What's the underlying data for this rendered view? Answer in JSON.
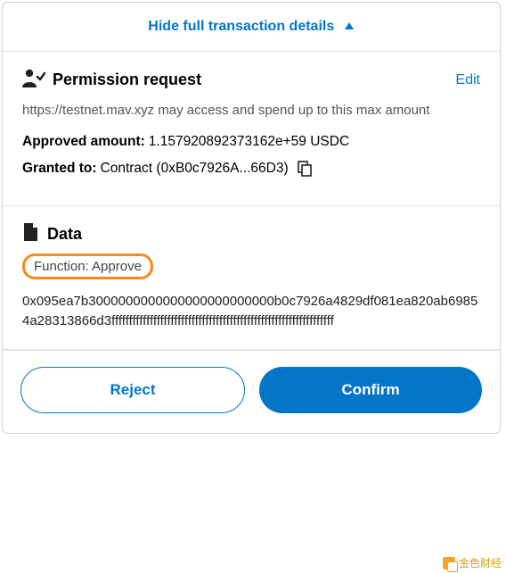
{
  "toggle": {
    "label": "Hide full transaction details"
  },
  "permission": {
    "heading": "Permission request",
    "edit": "Edit",
    "description": "https://testnet.mav.xyz may access and spend up to this max amount",
    "approved_label": "Approved amount:",
    "approved_value": "1.157920892373162e+59 USDC",
    "granted_label": "Granted to:",
    "granted_value": "Contract (0xB0c7926A...66D3)"
  },
  "data_section": {
    "heading": "Data",
    "function_label": "Function: Approve",
    "hex": "0x095ea7b3000000000000000000000000b0c7926a4829df081ea820ab69854a28313866d3ffffffffffffffffffffffffffffffffffffffffffffffffffffffffffffffff"
  },
  "footer": {
    "reject": "Reject",
    "confirm": "Confirm"
  },
  "watermark": {
    "text": "金色财经"
  }
}
